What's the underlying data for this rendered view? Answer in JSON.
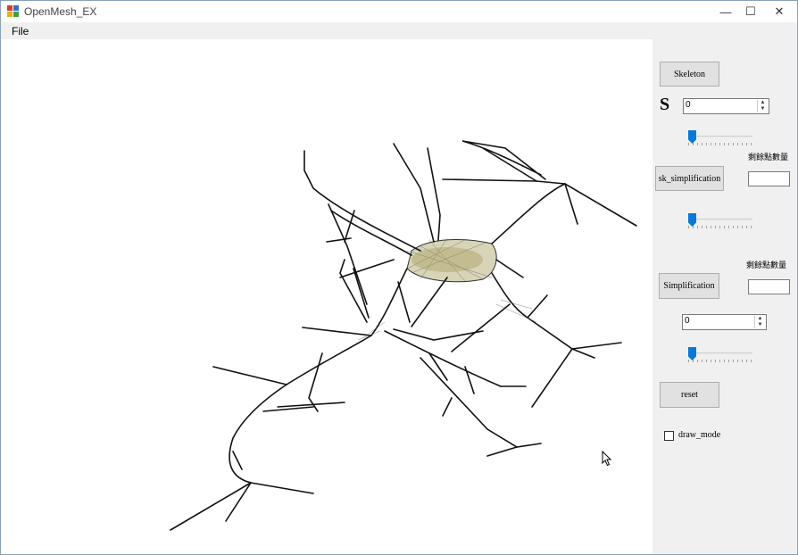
{
  "window": {
    "title": "OpenMesh_EX",
    "controls": {
      "minimize": "—",
      "maximize": "☐",
      "close": "✕"
    }
  },
  "menu": {
    "file": "File"
  },
  "panel": {
    "skeleton_button": "Skeleton",
    "s_label": "S",
    "s_spin_value": "0",
    "remaining_points_label_1": "剩餘點數量",
    "sk_simplification_button": "sk_simplification",
    "remaining_points_label_2": "剩餘點數量",
    "simplification_button": "Simplification",
    "simplification_spin_value": "0",
    "reset_button": "reset",
    "draw_mode_label": "draw_mode"
  },
  "colors": {
    "slider_thumb": "#0a78d7",
    "panel_bg": "#f0f0f0",
    "mesh_stroke": "#111111",
    "mesh_core": "#8a8a4a"
  }
}
